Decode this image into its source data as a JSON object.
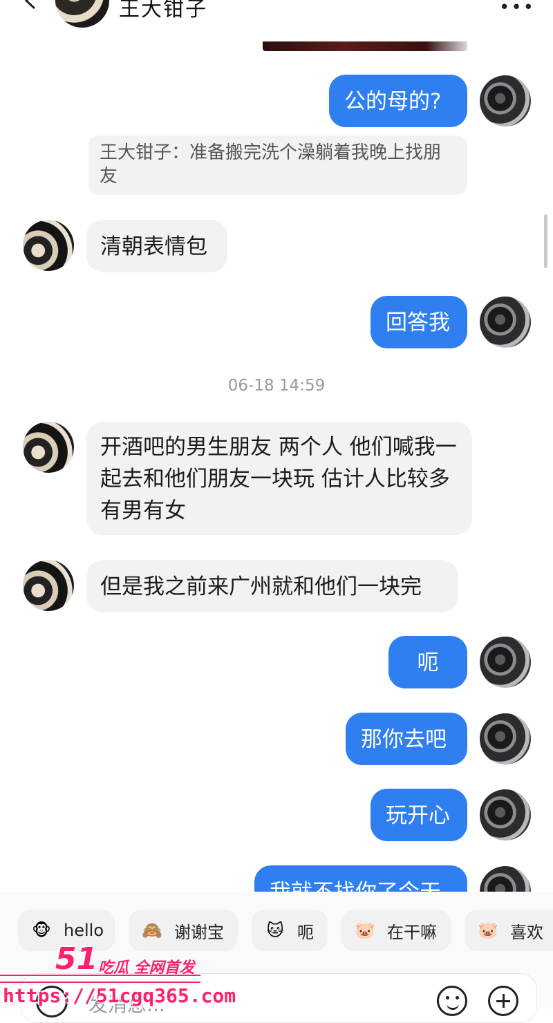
{
  "header": {
    "title": "王大钳子",
    "back_icon": "chevron-left-icon",
    "more_icon": "more-dots-icon",
    "more_label": "•••"
  },
  "messages": [
    {
      "side": "out",
      "text": "公的母的?"
    },
    {
      "quote": "王大钳子：准备搬完洗个澡躺着我晚上找朋友"
    },
    {
      "side": "in",
      "text": "清朝表情包"
    },
    {
      "side": "out",
      "text": "回答我"
    },
    {
      "timestamp": "06-18 14:59"
    },
    {
      "side": "in",
      "text": "开酒吧的男生朋友 两个人 他们喊我一起去和他们朋友一块玩 估计人比较多 有男有女"
    },
    {
      "side": "in",
      "text": "但是我之前来广州就和他们一块完"
    },
    {
      "side": "out",
      "text": "呃"
    },
    {
      "side": "out",
      "text": "那你去吧"
    },
    {
      "side": "out",
      "text": "玩开心"
    },
    {
      "side": "out",
      "text": "我就不找你了今天"
    }
  ],
  "quick_replies": [
    {
      "emoji": "🐵",
      "label": "hello"
    },
    {
      "emoji": "🙈",
      "label": "谢谢宝"
    },
    {
      "emoji": "🐱",
      "label": "呃"
    },
    {
      "emoji": "🐷",
      "label": "在干嘛"
    },
    {
      "emoji": "🐷",
      "label": "喜欢"
    }
  ],
  "input": {
    "placeholder": "发消息...",
    "voice_icon": "voice-icon",
    "emoji_icon": "smile-icon",
    "plus_icon": "plus-icon"
  },
  "watermark": {
    "logo": "51",
    "tagline": "吃瓜 全网首发",
    "url": "https://51cgq365.com"
  },
  "colors": {
    "outgoing_bubble": "#2f7ff0",
    "incoming_bubble": "#f2f2f4",
    "watermark": "#ff1f6b"
  }
}
